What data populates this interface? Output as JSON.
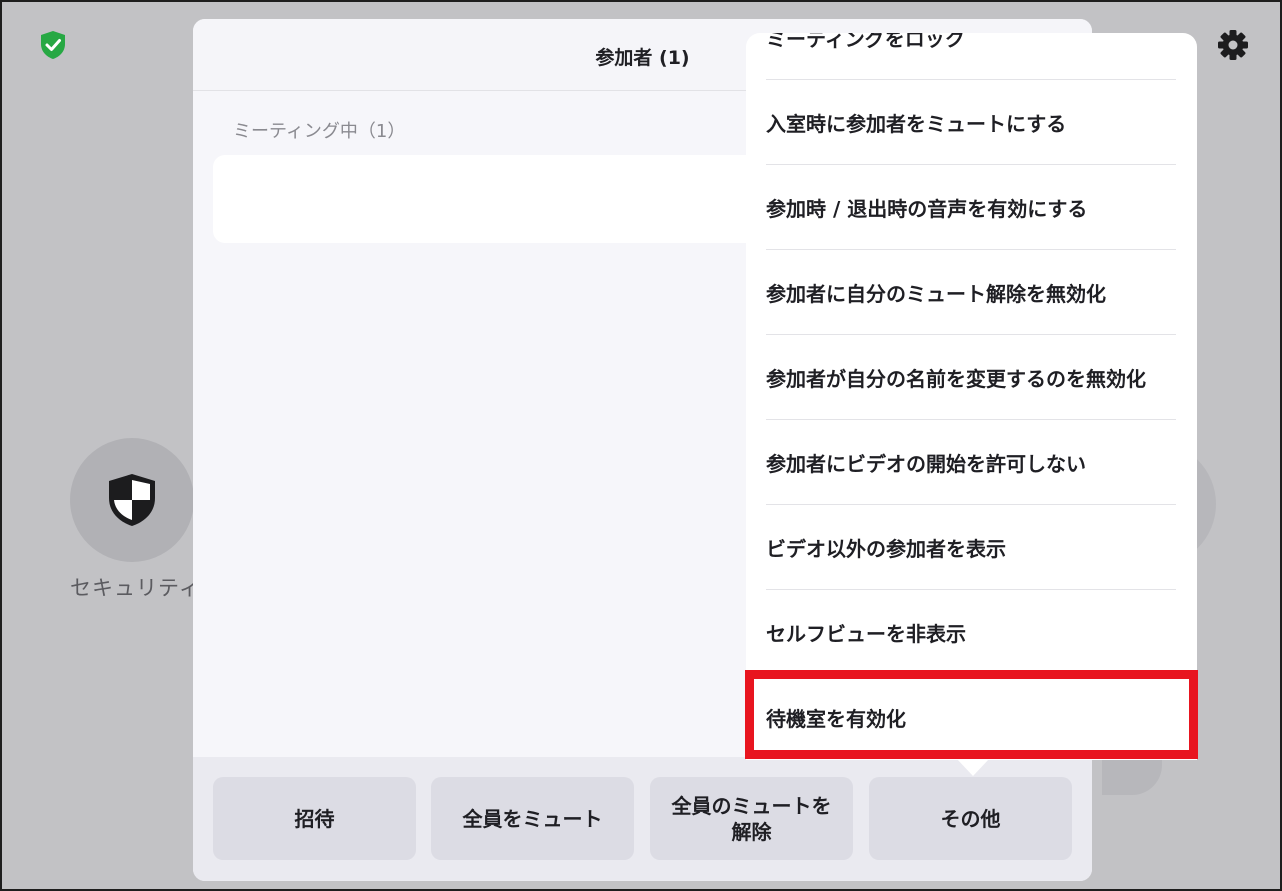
{
  "background": {
    "security_label": "セキュリティ",
    "icons": [
      "shield-check-icon",
      "gear-icon",
      "security-shield-icon"
    ]
  },
  "panel": {
    "title": "参加者 (1)",
    "section_label": "ミーティング中（1）",
    "footer_buttons": [
      {
        "label": "招待"
      },
      {
        "label": "全員をミュート"
      },
      {
        "label": "全員のミュートを\n解除"
      },
      {
        "label": "その他"
      }
    ]
  },
  "menu": {
    "items": [
      {
        "label": "ミーティングをロック"
      },
      {
        "label": "入室時に参加者をミュートにする"
      },
      {
        "label": "参加時 / 退出時の音声を有効にする"
      },
      {
        "label": "参加者に自分のミュート解除を無効化"
      },
      {
        "label": "参加者が自分の名前を変更するのを無効化"
      },
      {
        "label": "参加者にビデオの開始を許可しない"
      },
      {
        "label": "ビデオ以外の参加者を表示"
      },
      {
        "label": "セルフビューを非表示"
      },
      {
        "label": "待機室を有効化"
      }
    ],
    "highlighted_item": "待機室を有効化"
  },
  "colors": {
    "accent_green": "#27a844",
    "highlight_red": "#e8151f"
  }
}
